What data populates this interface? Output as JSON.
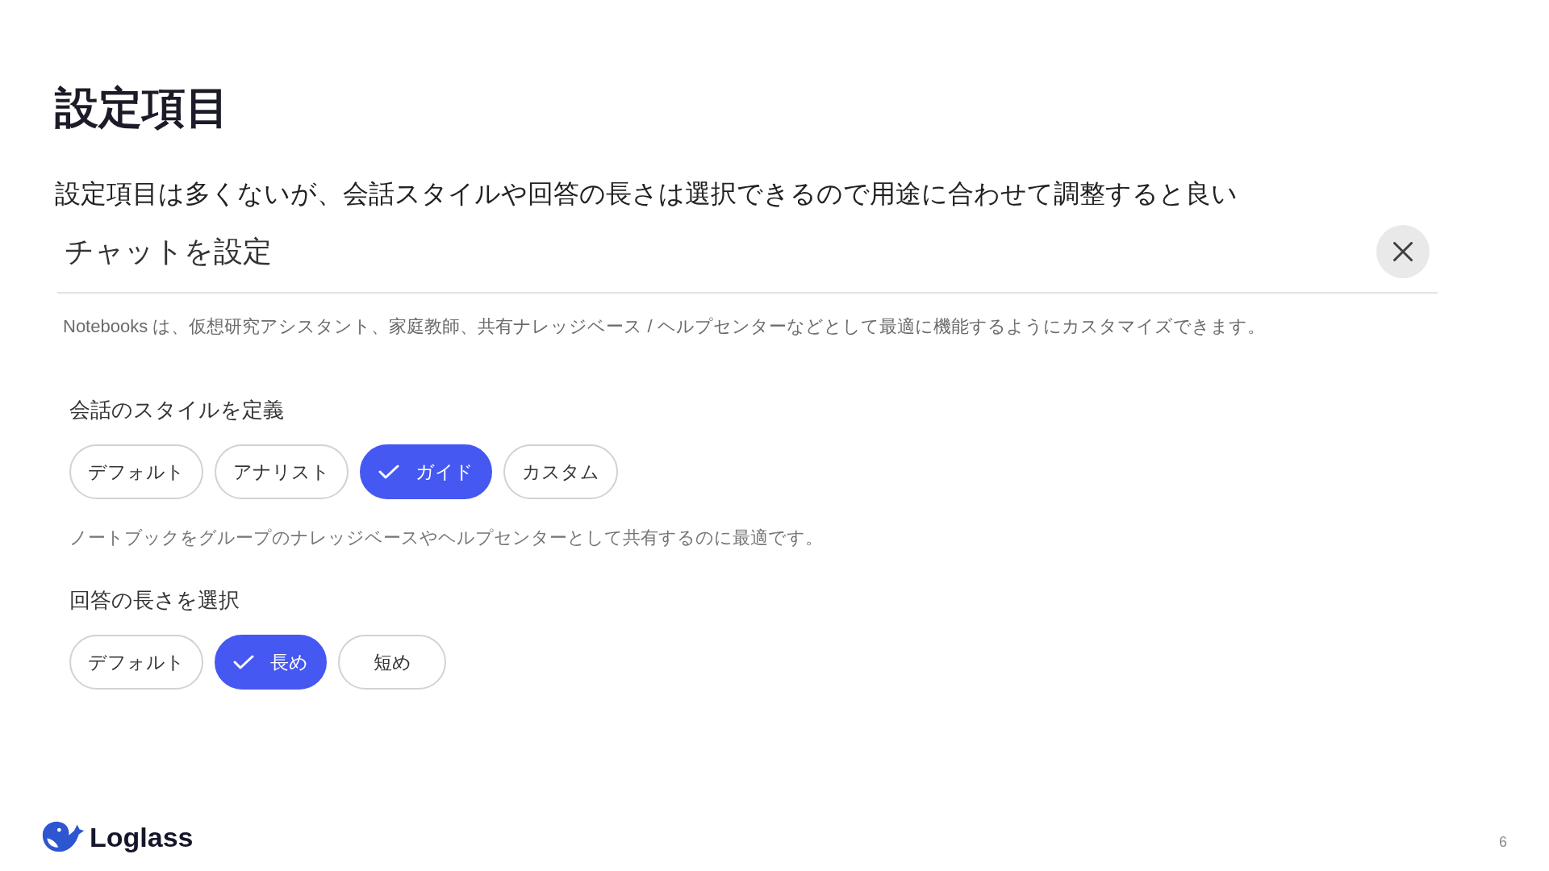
{
  "slide": {
    "title": "設定項目",
    "subtitle": "設定項目は多くないが、会話スタイルや回答の長さは選択できるので用途に合わせて調整すると良い"
  },
  "dialog": {
    "title": "チャットを設定",
    "description": "Notebooks は、仮想研究アシスタント、家庭教師、共有ナレッジベース / ヘルプセンターなどとして最適に機能するようにカスタマイズできます。",
    "sections": [
      {
        "label": "会話のスタイルを定義",
        "options": [
          {
            "label": "デフォルト",
            "selected": false
          },
          {
            "label": "アナリスト",
            "selected": false
          },
          {
            "label": "ガイド",
            "selected": true
          },
          {
            "label": "カスタム",
            "selected": false
          }
        ],
        "note": "ノートブックをグループのナレッジベースやヘルプセンターとして共有するのに最適です。"
      },
      {
        "label": "回答の長さを選択",
        "options": [
          {
            "label": "デフォルト",
            "selected": false
          },
          {
            "label": "長め",
            "selected": true
          },
          {
            "label": "短め",
            "selected": false
          }
        ]
      }
    ]
  },
  "footer": {
    "logo_text": "Loglass",
    "page_number": "6"
  }
}
